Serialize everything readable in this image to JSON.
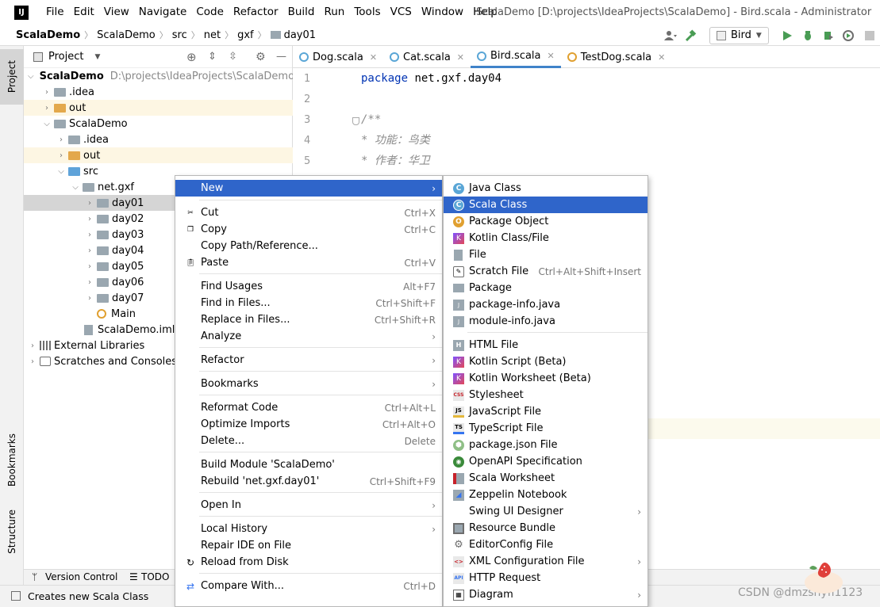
{
  "menubar": {
    "items": [
      "File",
      "Edit",
      "View",
      "Navigate",
      "Code",
      "Refactor",
      "Build",
      "Run",
      "Tools",
      "VCS",
      "Window",
      "Help"
    ],
    "window_title": "ScalaDemo [D:\\projects\\IdeaProjects\\ScalaDemo] - Bird.scala - Administrator"
  },
  "navbar": {
    "crumbs": [
      "ScalaDemo",
      "ScalaDemo",
      "src",
      "net",
      "gxf",
      "day01"
    ],
    "run_config": "Bird"
  },
  "leftstripe": {
    "project": "Project",
    "bookmarks": "Bookmarks",
    "structure": "Structure"
  },
  "project_panel": {
    "title": "Project",
    "tree": [
      {
        "label": "ScalaDemo",
        "path": "D:\\projects\\IdeaProjects\\ScalaDemo"
      },
      {
        "label": ".idea"
      },
      {
        "label": "out"
      },
      {
        "label": "ScalaDemo"
      },
      {
        "label": ".idea"
      },
      {
        "label": "out"
      },
      {
        "label": "src"
      },
      {
        "label": "net.gxf"
      },
      {
        "label": "day01"
      },
      {
        "label": "day02"
      },
      {
        "label": "day03"
      },
      {
        "label": "day04"
      },
      {
        "label": "day05"
      },
      {
        "label": "day06"
      },
      {
        "label": "day07"
      },
      {
        "label": "Main"
      },
      {
        "label": "ScalaDemo.iml"
      },
      {
        "label": "External Libraries"
      },
      {
        "label": "Scratches and Consoles"
      }
    ]
  },
  "editor": {
    "tabs": [
      "Dog.scala",
      "Cat.scala",
      "Bird.scala",
      "TestDog.scala"
    ],
    "active_tab": "Bird.scala",
    "line_numbers": [
      "1",
      "2",
      "3",
      "4",
      "5"
    ],
    "code": {
      "kw": "package",
      "pkg": "net.gxf.day04",
      "comment_open": "/**",
      "comment1": " * 功能：鸟类",
      "comment2": " * 作者：华卫"
    }
  },
  "context_menu": {
    "items": [
      {
        "label": "New"
      },
      {
        "label": "Cut",
        "shortcut": "Ctrl+X"
      },
      {
        "label": "Copy",
        "shortcut": "Ctrl+C"
      },
      {
        "label": "Copy Path/Reference..."
      },
      {
        "label": "Paste",
        "shortcut": "Ctrl+V"
      },
      {
        "label": "Find Usages",
        "shortcut": "Alt+F7"
      },
      {
        "label": "Find in Files...",
        "shortcut": "Ctrl+Shift+F"
      },
      {
        "label": "Replace in Files...",
        "shortcut": "Ctrl+Shift+R"
      },
      {
        "label": "Analyze"
      },
      {
        "label": "Refactor"
      },
      {
        "label": "Bookmarks"
      },
      {
        "label": "Reformat Code",
        "shortcut": "Ctrl+Alt+L"
      },
      {
        "label": "Optimize Imports",
        "shortcut": "Ctrl+Alt+O"
      },
      {
        "label": "Delete...",
        "shortcut": "Delete"
      },
      {
        "label": "Build Module 'ScalaDemo'"
      },
      {
        "label": "Rebuild 'net.gxf.day01'",
        "shortcut": "Ctrl+Shift+F9"
      },
      {
        "label": "Open In"
      },
      {
        "label": "Local History"
      },
      {
        "label": "Repair IDE on File"
      },
      {
        "label": "Reload from Disk"
      },
      {
        "label": "Compare With...",
        "shortcut": "Ctrl+D"
      }
    ]
  },
  "new_submenu": {
    "items": [
      {
        "label": "Java Class"
      },
      {
        "label": "Scala Class"
      },
      {
        "label": "Package Object"
      },
      {
        "label": "Kotlin Class/File"
      },
      {
        "label": "File"
      },
      {
        "label": "Scratch File",
        "shortcut": "Ctrl+Alt+Shift+Insert"
      },
      {
        "label": "Package"
      },
      {
        "label": "package-info.java"
      },
      {
        "label": "module-info.java"
      },
      {
        "label": "HTML File"
      },
      {
        "label": "Kotlin Script (Beta)"
      },
      {
        "label": "Kotlin Worksheet (Beta)"
      },
      {
        "label": "Stylesheet"
      },
      {
        "label": "JavaScript File"
      },
      {
        "label": "TypeScript File"
      },
      {
        "label": "package.json File"
      },
      {
        "label": "OpenAPI Specification"
      },
      {
        "label": "Scala Worksheet"
      },
      {
        "label": "Zeppelin Notebook"
      },
      {
        "label": "Swing UI Designer"
      },
      {
        "label": "Resource Bundle"
      },
      {
        "label": "EditorConfig File"
      },
      {
        "label": "XML Configuration File"
      },
      {
        "label": "HTTP Request"
      },
      {
        "label": "Diagram"
      }
    ]
  },
  "bottom": {
    "version_control": "Version Control",
    "todo": "TODO"
  },
  "status": {
    "message": "Creates new Scala Class"
  },
  "watermark": "CSDN @dmzshyfl1123"
}
